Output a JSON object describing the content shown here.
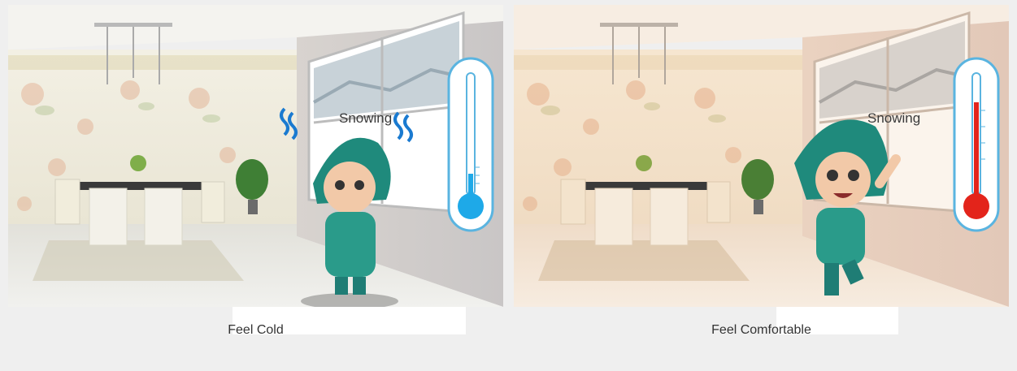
{
  "scenes": [
    {
      "weather_label": "Snowing",
      "caption": "Feel Cold",
      "mood": "cold",
      "thermometer_color": "#1ea9e8",
      "thermometer_level": 0.15
    },
    {
      "weather_label": "Snowing",
      "caption": "Feel Comfortable",
      "mood": "comfortable",
      "thermometer_color": "#e3241b",
      "thermometer_level": 0.75
    }
  ],
  "colors": {
    "page_background": "#efefef",
    "thermometer_outline": "#5ab4e0",
    "cold_tint": "#ece9dc",
    "warm_tint": "#f3dcc6"
  }
}
